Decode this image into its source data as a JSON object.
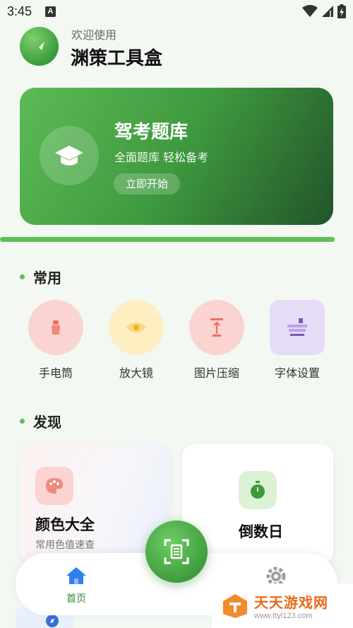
{
  "status_bar": {
    "time": "3:45",
    "notification_letter": "A"
  },
  "header": {
    "welcome": "欢迎使用",
    "title": "渊策工具盒"
  },
  "banner": {
    "title": "驾考题库",
    "subtitle": "全面题库 轻松备考",
    "button": "立即开始"
  },
  "sections": {
    "common": "常用",
    "discover": "发现"
  },
  "tools": [
    {
      "label": "手电筒",
      "icon": "flashlight-icon",
      "color": "#fbd3d0"
    },
    {
      "label": "放大镜",
      "icon": "magnifier-eye-icon",
      "color": "#fdefc2"
    },
    {
      "label": "图片压缩",
      "icon": "image-compress-icon",
      "color": "#fbd3d0"
    },
    {
      "label": "字体设置",
      "icon": "font-settings-icon",
      "color": "#e5dcf5"
    }
  ],
  "cards": {
    "color": {
      "title": "颜色大全",
      "subtitle": "常用色值速查",
      "icon": "palette-icon"
    },
    "countdown": {
      "title": "倒数日",
      "icon": "stopwatch-icon"
    }
  },
  "bottom_nav": {
    "home_label": "首页"
  },
  "watermark": {
    "main": "天天游戏网",
    "url": "www.ttyl123.com"
  },
  "colors": {
    "accent": "#5fbe55",
    "accent_dark": "#22542a",
    "home_active": "#2f80ed"
  }
}
